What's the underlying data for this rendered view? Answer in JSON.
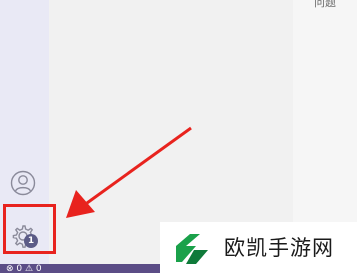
{
  "right_panel": {
    "label": "问题"
  },
  "activity_bar": {
    "account_icon": "account-icon",
    "settings_icon": "gear-icon",
    "settings_badge": "1"
  },
  "status_bar": {
    "icons": [
      "remote-icon",
      "warning-icon"
    ],
    "text": "⊗ 0 ⚠ 0"
  },
  "colors": {
    "highlight": "#e8231e",
    "badge": "#5b5b87",
    "status_bar": "#5b4d86",
    "activity_bar": "#e9e9f5",
    "logo": "#1aa14a"
  },
  "watermark": {
    "text": "欧凯手游网"
  }
}
